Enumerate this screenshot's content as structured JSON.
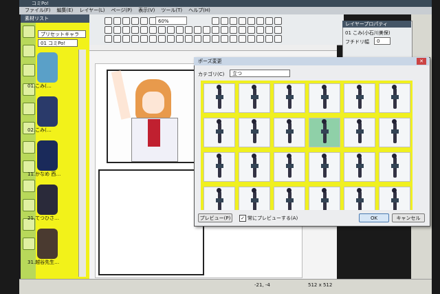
{
  "window": {
    "title": "コミPo!"
  },
  "menu": [
    "ファイル(F)",
    "編集(E)",
    "レイヤー(L)",
    "ページ(P)",
    "表示(V)",
    "ツール(T)",
    "ヘルプ(H)"
  ],
  "toolbar": {
    "zoom": "60%"
  },
  "sidebar": {
    "title": "素材リスト",
    "preset": "プリセットキャラ",
    "page_combo": "01 コミPo!",
    "characters": [
      "01.こみ(…",
      "02.こみ(…",
      "11.かなめ 西…",
      "21.てつひさ…",
      "31.越谷先生…"
    ]
  },
  "layer_props": {
    "title": "レイヤープロパティ",
    "layer_name": "01 こみ(小石川美保)",
    "edge_label": "フチドリ幅",
    "edge_value": "0"
  },
  "dialog": {
    "title": "ポーズ変更",
    "category_label": "カテゴリ(C)",
    "category_value": "立つ",
    "selected_index": 9,
    "preview_button": "プレビュー(P)",
    "always_preview_label": "常にプレビューする(A)",
    "always_preview_checked": "✓",
    "ok": "OK",
    "cancel": "キャンセル"
  },
  "status": {
    "coords": "-21, -4",
    "size": "512 x 512"
  },
  "colors": {
    "accent": "#f2f21a",
    "dialog_selected": "#8fd0a8"
  },
  "icons": [
    "close-icon"
  ]
}
